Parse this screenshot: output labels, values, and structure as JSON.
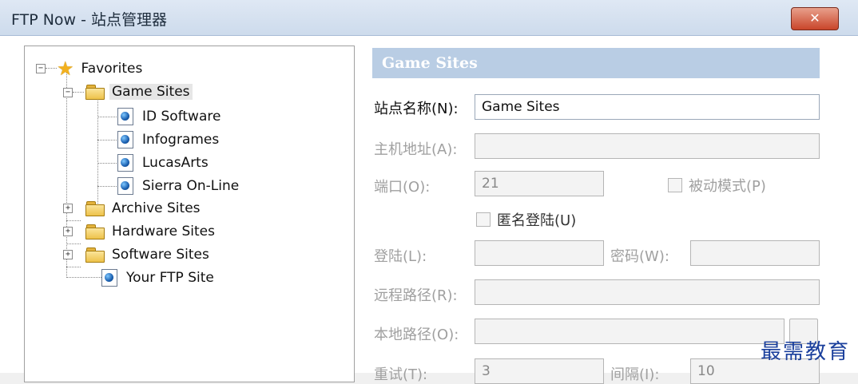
{
  "window": {
    "title": "FTP Now - 站点管理器",
    "close_label": "✕"
  },
  "tree": {
    "root": "Favorites",
    "game_sites": "Game Sites",
    "game_children": [
      "ID Software",
      "Infogrames",
      "LucasArts",
      "Sierra On-Line"
    ],
    "archive_sites": "Archive Sites",
    "hardware_sites": "Hardware Sites",
    "software_sites": "Software Sites",
    "your_ftp_site": "Your FTP Site"
  },
  "details": {
    "header": "Game Sites",
    "site_name_label": "站点名称(N):",
    "site_name_value": "Game Sites",
    "host_label": "主机地址(A):",
    "host_value": "",
    "port_label": "端口(O):",
    "port_value": "21",
    "passive_label": "被动模式(P)",
    "anonymous_label": "匿名登陆(U)",
    "login_label": "登陆(L):",
    "login_value": "",
    "password_label": "密码(W):",
    "password_value": "",
    "remote_path_label": "远程路径(R):",
    "remote_path_value": "",
    "local_path_label": "本地路径(O):",
    "local_path_value": "",
    "retry_label": "重试(T):",
    "retry_value": "3",
    "interval_label": "间隔(I):",
    "interval_value": "10"
  },
  "watermark": "最需教育"
}
